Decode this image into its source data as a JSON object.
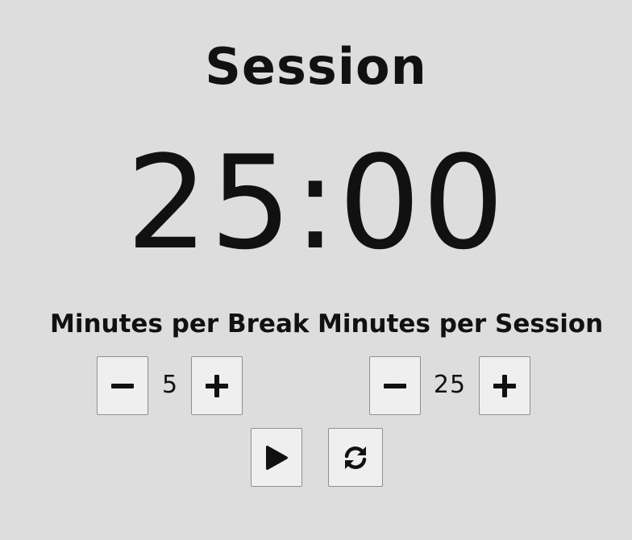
{
  "mode_label": "Session",
  "timer_display": "25:00",
  "break_control": {
    "label": "Minutes per Break",
    "value": "5",
    "decrement_icon": "minus-icon",
    "increment_icon": "plus-icon"
  },
  "session_control": {
    "label": "Minutes per Session",
    "value": "25",
    "decrement_icon": "minus-icon",
    "increment_icon": "plus-icon"
  },
  "controls": {
    "start_icon": "play-icon",
    "reset_icon": "refresh-icon"
  },
  "colors": {
    "background": "#dddddd",
    "button_background": "#efefef",
    "button_border": "#8f8f8f",
    "text": "#111111"
  }
}
